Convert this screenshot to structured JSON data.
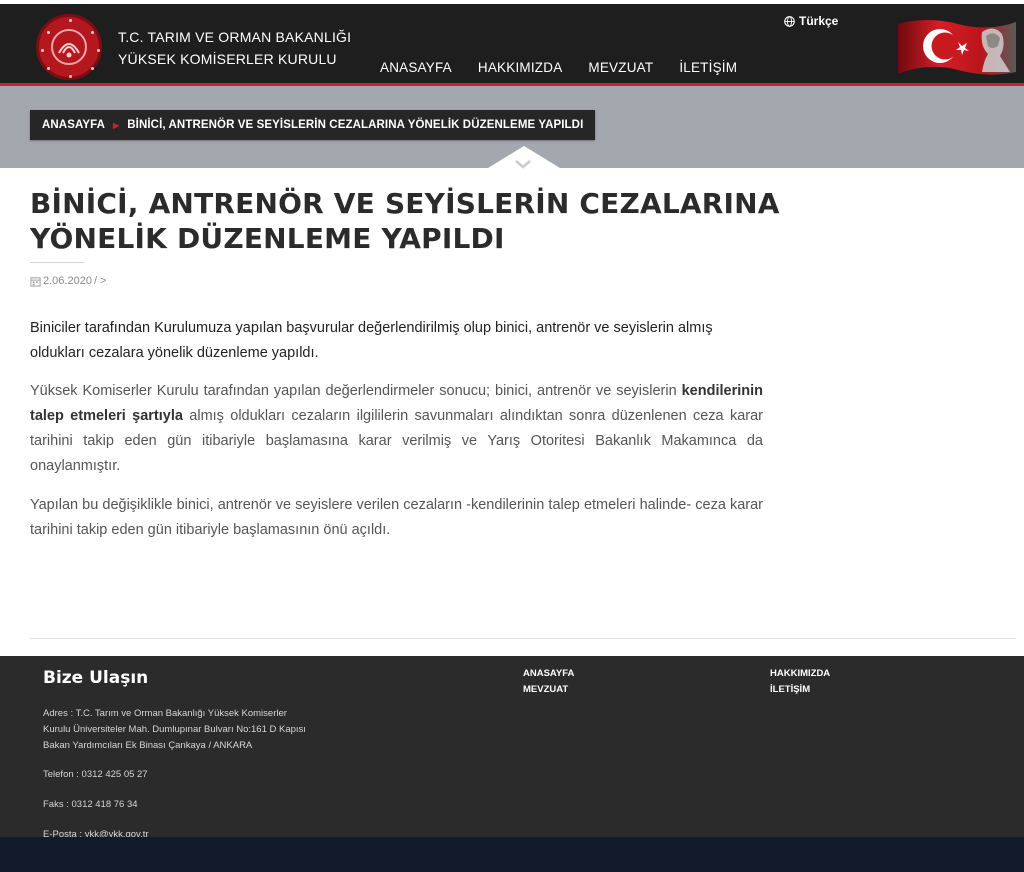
{
  "header": {
    "org_line1": "T.C. TARIM VE ORMAN BAKANLIĞI",
    "org_line2": "YÜKSEK KOMİSERLER KURULU",
    "nav": [
      "ANASAYFA",
      "HAKKIMIZDA",
      "MEVZUAT",
      "İLETİŞİM"
    ],
    "language": "Türkçe",
    "language_icon": "globe-icon"
  },
  "breadcrumb": {
    "home": "ANASAYFA",
    "current": "BİNİCİ, ANTRENÖR VE SEYİSLERİN CEZALARINA YÖNELİK DÜZENLEME YAPILDI",
    "separator_icon": "caret-right-icon"
  },
  "article": {
    "title": "BİNİCİ, ANTRENÖR VE SEYİSLERİN CEZALARINA YÖNELİK DÜZENLEME YAPILDI",
    "date": "2.06.2020",
    "meta_suffix": " / >",
    "p1": "Biniciler tarafından Kurulumuza yapılan başvurular değerlendirilmiş olup binici, antrenör ve seyislerin almış oldukları cezalara yönelik düzenleme yapıldı.",
    "p2_before": "Yüksek Komiserler Kurulu tarafından yapılan değerlendirmeler sonucu; binici, antrenör ve seyislerin ",
    "p2_bold": "kendilerinin talep etmeleri şartıyla",
    "p2_after": " almış oldukları cezaların ilgililerin savunmaları alındıktan sonra düzenlenen ceza karar tarihini takip eden gün itibariyle başlamasına karar verilmiş ve Yarış Otoritesi Bakanlık Makamınca da onaylanmıştır.",
    "p3": "Yapılan bu değişiklikle binici, antrenör ve seyislere verilen cezaların -kendilerinin talep etmeleri halinde- ceza karar tarihini takip eden gün itibariyle başlamasının önü açıldı."
  },
  "footer": {
    "title": "Bize Ulaşın",
    "address": "Adres : T.C. Tarım ve Orman Bakanlığı Yüksek Komiserler Kurulu Üniversiteler Mah. Dumlupınar Bulvarı No:161 D Kapısı Bakan Yardımcıları Ek Binası Çankaya / ANKARA",
    "phone": "Telefon : 0312 425 05 27",
    "fax": "Faks : 0312 418 76 34",
    "email": "E-Posta : ykk@ykk.gov.tr",
    "links_col1": [
      "ANASAYFA",
      "MEVZUAT"
    ],
    "links_col2": [
      "HAKKIMIZDA",
      "İLETİŞİM"
    ]
  },
  "colors": {
    "header_bg": "#1e1e1e",
    "accent_red": "#c0262c",
    "band_grey": "#a3a7ae",
    "footer_bg": "#2b2b2b"
  }
}
